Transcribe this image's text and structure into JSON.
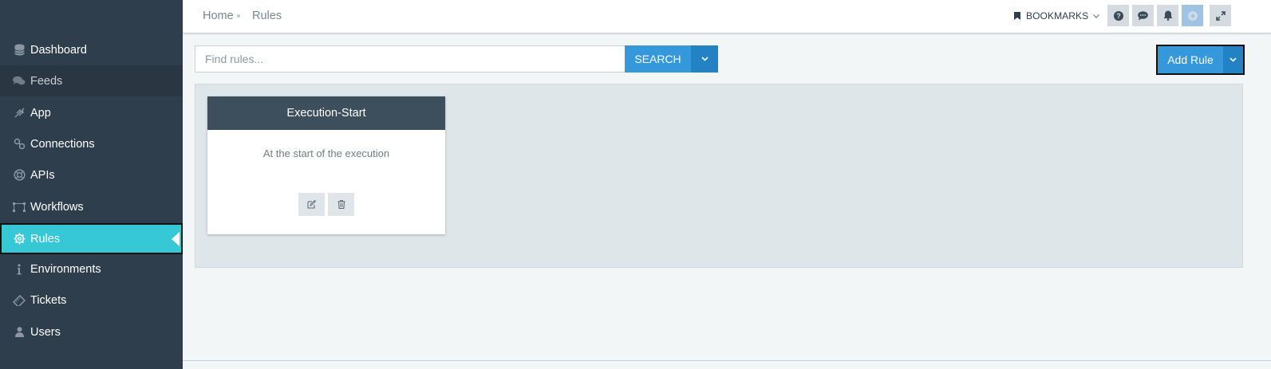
{
  "sidebar": {
    "items": [
      {
        "label": "Dashboard",
        "icon": "database-icon"
      },
      {
        "label": "Feeds",
        "icon": "comments-icon"
      },
      {
        "label": "App",
        "icon": "hand-icon"
      },
      {
        "label": "Connections",
        "icon": "link-icon"
      },
      {
        "label": "APIs",
        "icon": "lifebuoy-icon"
      },
      {
        "label": "Workflows",
        "icon": "workflow-icon"
      },
      {
        "label": "Rules",
        "icon": "gear-icon",
        "active": true
      },
      {
        "label": "Environments",
        "icon": "info-icon"
      },
      {
        "label": "Tickets",
        "icon": "ticket-icon"
      },
      {
        "label": "Users",
        "icon": "user-icon"
      }
    ]
  },
  "header": {
    "breadcrumb": [
      "Home",
      "Rules"
    ],
    "bookmarks_label": "BOOKMARKS",
    "buttons": [
      "help-icon",
      "chat-icon",
      "bell-icon",
      "plus-circle-icon",
      "expand-icon"
    ]
  },
  "search": {
    "placeholder": "Find rules...",
    "button_label": "SEARCH"
  },
  "actions": {
    "add_rule_label": "Add Rule"
  },
  "rules": [
    {
      "title": "Execution-Start",
      "description": "At the start of the execution"
    }
  ],
  "colors": {
    "sidebar_bg": "#2f3e4c",
    "active_item": "#36c8d6",
    "primary": "#3498db",
    "primary_dark": "#2382c4",
    "card_header": "#3d4e5c"
  }
}
